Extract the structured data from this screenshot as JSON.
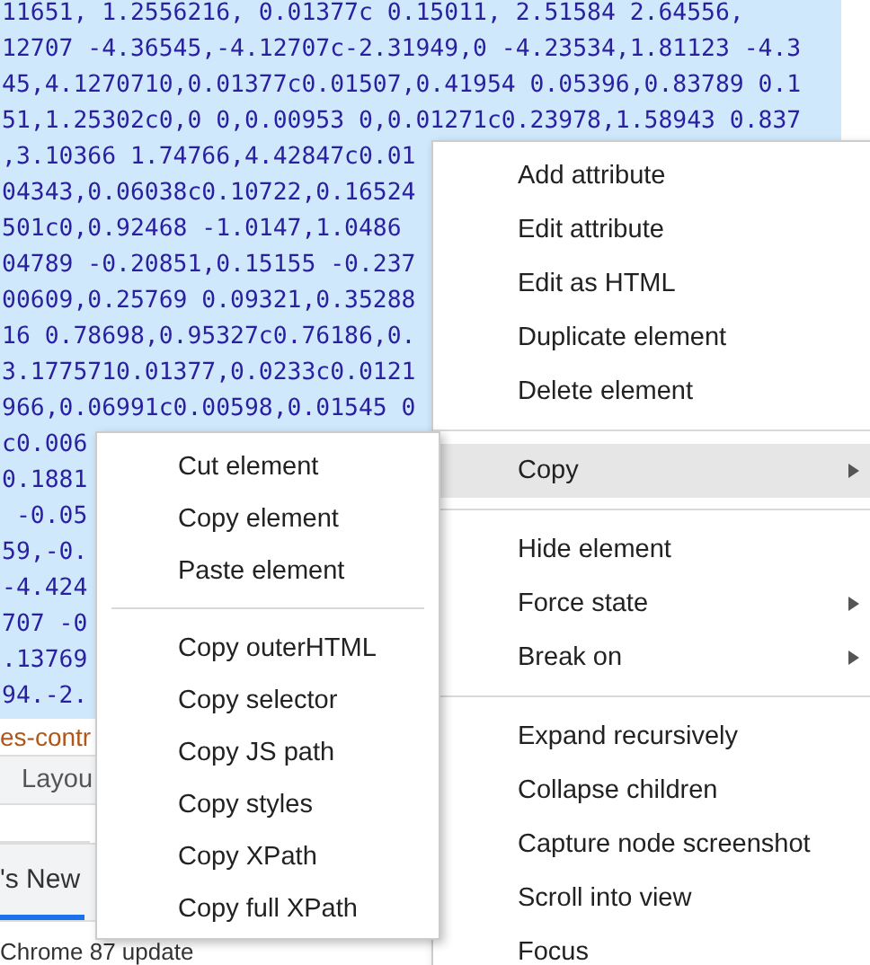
{
  "code_lines": [
    "11651, 1.2556216, 0.01377c 0.15011, 2.51584 2.64556,",
    "12707 -4.36545,-4.12707c-2.31949,0 -4.23534,1.81123 -4.3",
    "45,4.1270710,0.01377c0.01507,0.41954 0.05396,0.83789 0.1",
    "51,1.25302c0,0 0,0.00953 0,0.01271c0.23978,1.58943 0.837",
    ",3.10366 1.74766,4.42847c0.01",
    "04343,0.06038c0.10722,0.16524",
    "501c0,0.92468 -1.0147,1.0486",
    "04789 -0.20851,0.15155 -0.237",
    "00609,0.25769 0.09321,0.35288",
    "16 0.78698,0.95327c0.76186,0.",
    "3.1775710.01377,0.0233c0.0121",
    "966,0.06991c0.00598,0.01545 0",
    "c0.006",
    "0.1881",
    " -0.05",
    "59,-0.",
    "-4.424",
    "707 -0",
    ".13769",
    "94.-2."
  ],
  "breadcrumb": "es-contr",
  "panel_tabs": [
    {
      "label": "Layou",
      "selected": false
    }
  ],
  "drawer_tabs": [
    {
      "label": "'s New",
      "selected": true
    }
  ],
  "drawer_text": "Chrome 87 update",
  "context_menu": {
    "items": [
      {
        "kind": "item",
        "label": "Add attribute",
        "selected": false,
        "has_submenu": false
      },
      {
        "kind": "item",
        "label": "Edit attribute",
        "selected": false,
        "has_submenu": false
      },
      {
        "kind": "item",
        "label": "Edit as HTML",
        "selected": false,
        "has_submenu": false
      },
      {
        "kind": "item",
        "label": "Duplicate element",
        "selected": false,
        "has_submenu": false
      },
      {
        "kind": "item",
        "label": "Delete element",
        "selected": false,
        "has_submenu": false
      },
      {
        "kind": "separator"
      },
      {
        "kind": "item",
        "label": "Copy",
        "selected": true,
        "has_submenu": true
      },
      {
        "kind": "separator"
      },
      {
        "kind": "item",
        "label": "Hide element",
        "selected": false,
        "has_submenu": false
      },
      {
        "kind": "item",
        "label": "Force state",
        "selected": false,
        "has_submenu": true
      },
      {
        "kind": "item",
        "label": "Break on",
        "selected": false,
        "has_submenu": true
      },
      {
        "kind": "separator"
      },
      {
        "kind": "item",
        "label": "Expand recursively",
        "selected": false,
        "has_submenu": false
      },
      {
        "kind": "item",
        "label": "Collapse children",
        "selected": false,
        "has_submenu": false
      },
      {
        "kind": "item",
        "label": "Capture node screenshot",
        "selected": false,
        "has_submenu": false
      },
      {
        "kind": "item",
        "label": "Scroll into view",
        "selected": false,
        "has_submenu": false
      },
      {
        "kind": "item",
        "label": "Focus",
        "selected": false,
        "has_submenu": false
      }
    ]
  },
  "submenu": {
    "items": [
      {
        "kind": "item",
        "label": "Cut element",
        "selected": false
      },
      {
        "kind": "item",
        "label": "Copy element",
        "selected": false
      },
      {
        "kind": "item",
        "label": "Paste element",
        "selected": false
      },
      {
        "kind": "separator"
      },
      {
        "kind": "item",
        "label": "Copy outerHTML",
        "selected": false
      },
      {
        "kind": "item",
        "label": "Copy selector",
        "selected": false
      },
      {
        "kind": "item",
        "label": "Copy JS path",
        "selected": false
      },
      {
        "kind": "item",
        "label": "Copy styles",
        "selected": false
      },
      {
        "kind": "item",
        "label": "Copy XPath",
        "selected": false
      },
      {
        "kind": "item",
        "label": "Copy full XPath",
        "selected": false
      }
    ]
  }
}
